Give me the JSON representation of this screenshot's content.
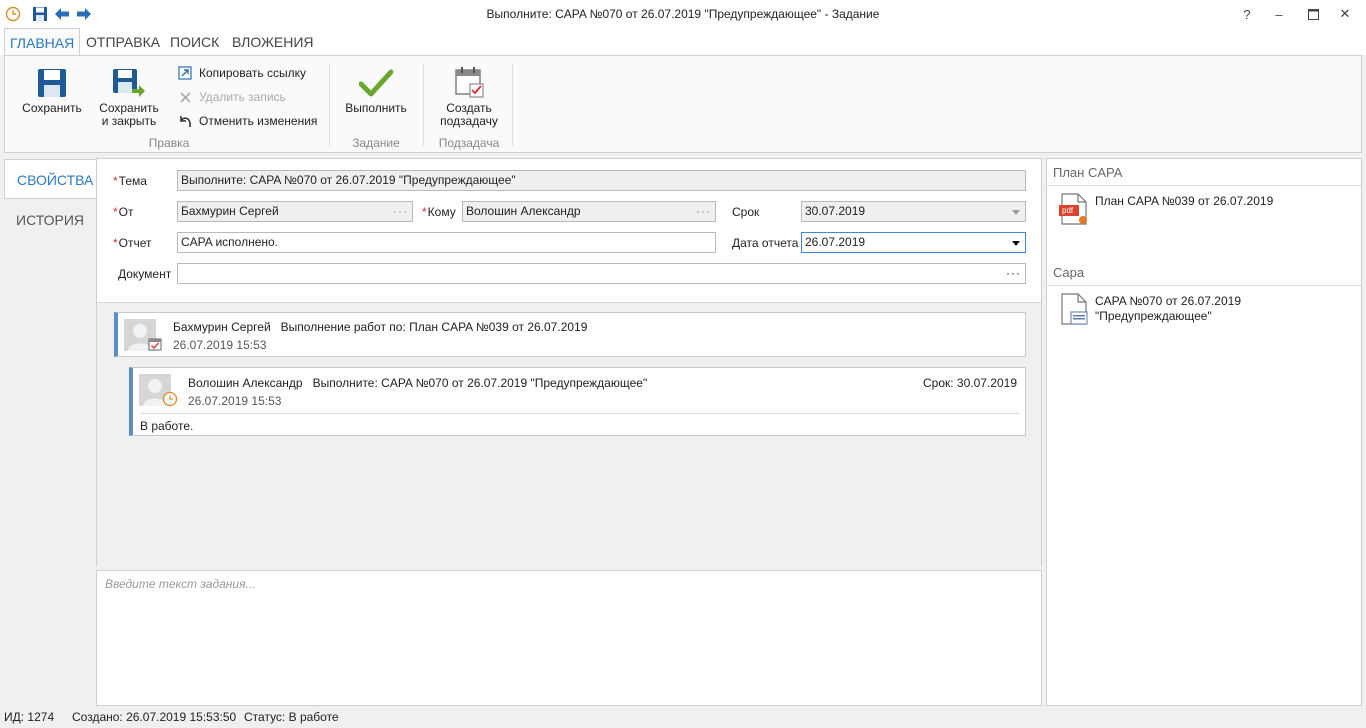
{
  "window": {
    "title": "Выполните: CAPA №070 от 26.07.2019 \"Предупреждающее\" - Задание",
    "help": "?",
    "minimize": "–",
    "close": "✕"
  },
  "ribbon": {
    "tabs": [
      "ГЛАВНАЯ",
      "ОТПРАВКА",
      "ПОИСК",
      "ВЛОЖЕНИЯ"
    ],
    "save": "Сохранить",
    "save_close_line1": "Сохранить",
    "save_close_line2": "и закрыть",
    "copy_link": "Копировать ссылку",
    "delete_record": "Удалить запись",
    "undo_changes": "Отменить изменения",
    "group_edit": "Правка",
    "execute": "Выполнить",
    "group_task": "Задание",
    "subtask_line1": "Создать",
    "subtask_line2": "подзадачу",
    "group_subtask": "Подзадача"
  },
  "sidetabs": {
    "properties": "СВОЙСТВА",
    "history": "ИСТОРИЯ"
  },
  "form": {
    "req": "*",
    "subject_label": "Тема",
    "subject_value": "Выполните: CAPA №070 от 26.07.2019 \"Предупреждающее\"",
    "from_label": "От",
    "from_value": "Бахмурин Сергей",
    "to_label": "Кому",
    "to_value": "Волошин Александр",
    "due_label": "Срок",
    "due_value": "30.07.2019",
    "report_label": "Отчет",
    "report_value": "CAPA исполнено.",
    "report_date_label": "Дата отчета",
    "report_date_value": "26.07.2019",
    "document_label": "Документ",
    "dots": "···"
  },
  "feed": {
    "card1": {
      "author": "Бахмурин Сергей",
      "title": "Выполнение работ по: План CAPA №039 от 26.07.2019",
      "time": "26.07.2019 15:53"
    },
    "card2": {
      "author": "Волошин Александр",
      "title": "Выполните: CAPA №070 от 26.07.2019 \"Предупреждающее\"",
      "due": "Срок: 30.07.2019",
      "time": "26.07.2019 15:53",
      "body": "В работе."
    }
  },
  "editor": {
    "placeholder": "Введите текст задания..."
  },
  "right": {
    "section1": "План CAPA",
    "item1": "План CAPA №039 от 26.07.2019",
    "pdf": "pdf",
    "section2": "Capa",
    "item2_line1": "CAPA №070 от 26.07.2019",
    "item2_line2": "\"Предупреждающее\""
  },
  "statusbar": {
    "id": "ИД: 1274",
    "created": "Создано: 26.07.2019 15:53:50",
    "status": "Статус: В работе"
  },
  "colors": {
    "accent": "#2b79c2",
    "required": "#d33333",
    "check": "#6aa82d",
    "card_border": "#5b8fc6"
  }
}
